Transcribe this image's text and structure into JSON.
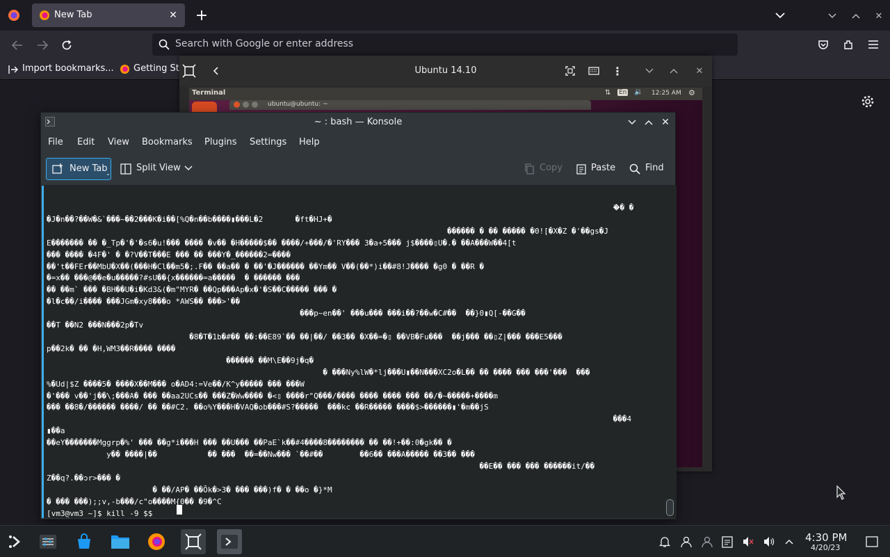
{
  "firefox": {
    "tab_title": "New Tab",
    "address_placeholder": "Search with Google or enter address",
    "bookmarks": [
      "Import bookmarks...",
      "Getting St"
    ]
  },
  "vm_window": {
    "title": "Ubuntu 14.10",
    "panel_title": "Terminal",
    "panel_lang": "En",
    "panel_time": "12:25 AM",
    "terminal_title": "ubuntu@ubuntu: ~"
  },
  "konsole": {
    "title": "~ : bash — Konsole",
    "menu": [
      "File",
      "Edit",
      "View",
      "Bookmarks",
      "Plugins",
      "Settings",
      "Help"
    ],
    "toolbar": {
      "new_tab": "New Tab",
      "split_view": "Split View",
      "copy": "Copy",
      "paste": "Paste",
      "find": "Find"
    },
    "terminal_text": "                                                                                                                           �ࣤ� �\n�J�n��?��W�&`���~��2���K�i��[%Q�n��b����▮���L�2       �ft�HJ+�\n                                                                                       ������ � �� ����� �0![�X�Z �'��gs�J\nE������� �� �_Tp�'�'�s6�u!��� ���� �v�� �H�����$�� ����/+���/�'RY��� 3�a+5��� j$����▯U�.� ��A���W��4[t\n��� ���� �4F�' � �?V��T���E ��� �� ���Y�_������2=����\n��'t��FEr��MbU�X��(���H�Cl��m5�;.F�� ��a�� � ��'�J������ ��Ym�� V��(��*)i��#8!J���� �g0 � ��R �\n�=x�� ���@��e�u�����?#sU��{x������=a�����  � ������ ���\n�� ��m` ��� �BH��U�i�Kd3&(�m\"MYR� ��Qp���Ap�x�'�S��C����� ��� �\n�l�c��/i���� ���JGm�xy8���o *AWS�� ���>'��\n                                                       ���p~en��' ���u��� ���i��?��w�C#��  ��}0▮Q[-��G��\n��T ��N2 ���N���2p�Tv\n                               �8�T�1b�#�� ��:��E89`�� ��|��/ ��3�� �X��=�▯ ��VB�Fu���  ��j��� ��▯Z|��� ���E5���\np��2k� �� �H,WM3��R���� ����\n                                       ������ ��M\\E��9j�q�\n                                                            � ���Ny%lW�*lj���U▮��N���XC2o�L�� �� ���� ��� ���'���  ���\n%�Ud|$Z ����5� ����X��M��� o�AD4:=Ve��/K^y����� ��� ���W\n�'��� v��'j��\\;���A� ��� ��aa2UCs�� ���Z�Ww���� �<▯ ����r\"Q���/���� ���� ���� ��� ��/�~�����+����m\n��� ��8�/������ ����/ �� ��#C2. ��o%Y���H�VAQ�ob���#S?�����  ���kc ��R����� ����$>������▮'�m��jS\n                                                                                                                           ���4\n▮��a\n��eY�������Mggrp�%' ��� ��g*i���H ��� ��U��� ��PaE`k��#4����8�������� �� ��!+��:0�gk�� �\n             y�� ����|��           �� ���  ��=��Nw��� `��#��        ��6�� ���A����� ��3�� ���\n                                                                                              ��E�� ��� ��� ������it/��\nZ��q?.��ↄr>��� �\n                       � ��/AP� ��Ōk�>3� ��� ���)f� � ��o �}*M\n� ��� ���);;v,-b���/c\"o����M{0�� �9�^C\n[vm3@vm3 ~]$ kill -9 $$"
  },
  "taskbar": {
    "time": "4:30 PM",
    "date": "4/20/23"
  },
  "colors": {
    "accent": "#3daee9",
    "konsole_bg": "#31363b",
    "terminal_bg": "#232627",
    "firefox_toolbar": "#2b2a33",
    "ubuntu_aubergine": "#5b1f42"
  }
}
